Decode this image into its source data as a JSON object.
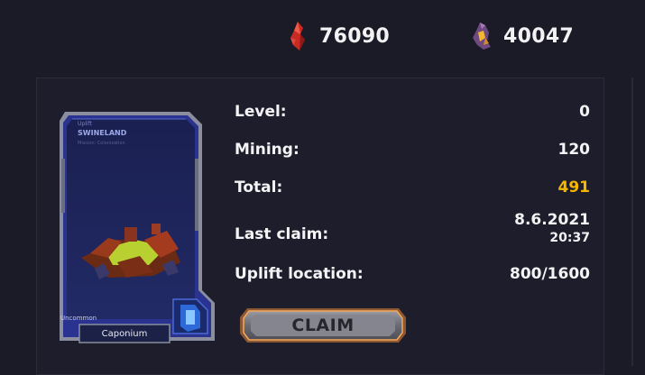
{
  "resources": [
    {
      "icon": "red-crystal-icon",
      "value": "76090",
      "color": "#d0302a"
    },
    {
      "icon": "purple-gold-crystal-icon",
      "value": "40047",
      "color": "#8a5a9a"
    }
  ],
  "card": {
    "type_text": "Uplift",
    "name": "SWINELAND",
    "subtitle": "Mission: Colonization",
    "rarity": "Uncommon",
    "label": "Caponium",
    "frame_color": "#3a4aa8",
    "emblem_icon": "shield-emblem-icon"
  },
  "stats": {
    "level_label": "Level:",
    "level_value": "0",
    "mining_label": "Mining:",
    "mining_value": "120",
    "total_label": "Total:",
    "total_value": "491",
    "last_claim_label": "Last claim:",
    "last_claim_date": "8.6.2021",
    "last_claim_time": "20:37",
    "uplift_label": "Uplift location:",
    "uplift_value": "800/1600"
  },
  "claim_button": {
    "label": "CLAIM"
  },
  "colors": {
    "background": "#1b1a27",
    "accent_gold": "#f5b800",
    "claim_glow": "#e8883a"
  }
}
